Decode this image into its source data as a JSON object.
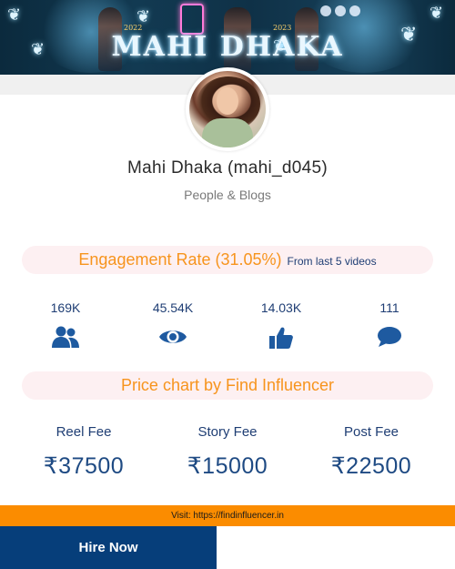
{
  "banner": {
    "text": "MAHI DHAKA",
    "mini_left": "2022",
    "mini_right": "2023"
  },
  "profile": {
    "name": "Mahi Dhaka (mahi_d045)",
    "category": "People & Blogs"
  },
  "engagement": {
    "title": "Engagement Rate (31.05%)",
    "subtitle": "From last 5 videos"
  },
  "stats": [
    {
      "value": "169K",
      "icon": "followers-icon"
    },
    {
      "value": "45.54K",
      "icon": "views-icon"
    },
    {
      "value": "14.03K",
      "icon": "likes-icon"
    },
    {
      "value": "111",
      "icon": "comments-icon"
    }
  ],
  "price_chart": {
    "title": "Price chart by Find Influencer"
  },
  "fees": [
    {
      "label": "Reel Fee",
      "amount": "₹37500"
    },
    {
      "label": "Story Fee",
      "amount": "₹15000"
    },
    {
      "label": "Post Fee",
      "amount": "₹22500"
    }
  ],
  "footer": {
    "visit_text": "Visit: https://findinfluencer.in",
    "hire_button": "Hire Now"
  },
  "colors": {
    "accent_orange": "#f7941d",
    "navy": "#1f3e74",
    "button_bg": "#063e7a",
    "pill_bg": "#fdf0f2",
    "visit_bar": "#fb8c00"
  }
}
